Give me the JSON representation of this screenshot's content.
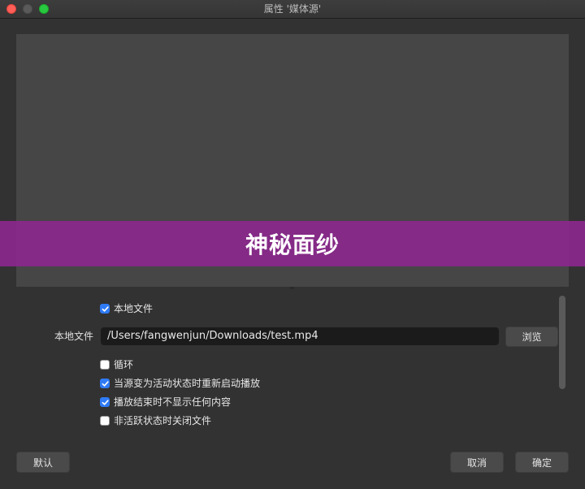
{
  "window": {
    "title": "属性 '媒体源'"
  },
  "banner": {
    "text": "神秘面纱"
  },
  "properties": {
    "local_file_checkbox": {
      "label": "本地文件",
      "checked": true
    },
    "local_file_field": {
      "label": "本地文件",
      "value": "/Users/fangwenjun/Downloads/test.mp4",
      "browse_label": "浏览"
    },
    "options": [
      {
        "label": "循环",
        "checked": false
      },
      {
        "label": "当源变为活动状态时重新启动播放",
        "checked": true
      },
      {
        "label": "播放结束时不显示任何内容",
        "checked": true
      },
      {
        "label": "非活跃状态时关闭文件",
        "checked": false
      }
    ]
  },
  "buttons": {
    "defaults_label": "默认",
    "cancel_label": "取消",
    "ok_label": "确定"
  },
  "colors": {
    "accent": "#2f7bf6",
    "banner": "#8a288c",
    "close": "#fe5f57",
    "maximize": "#28c840"
  }
}
